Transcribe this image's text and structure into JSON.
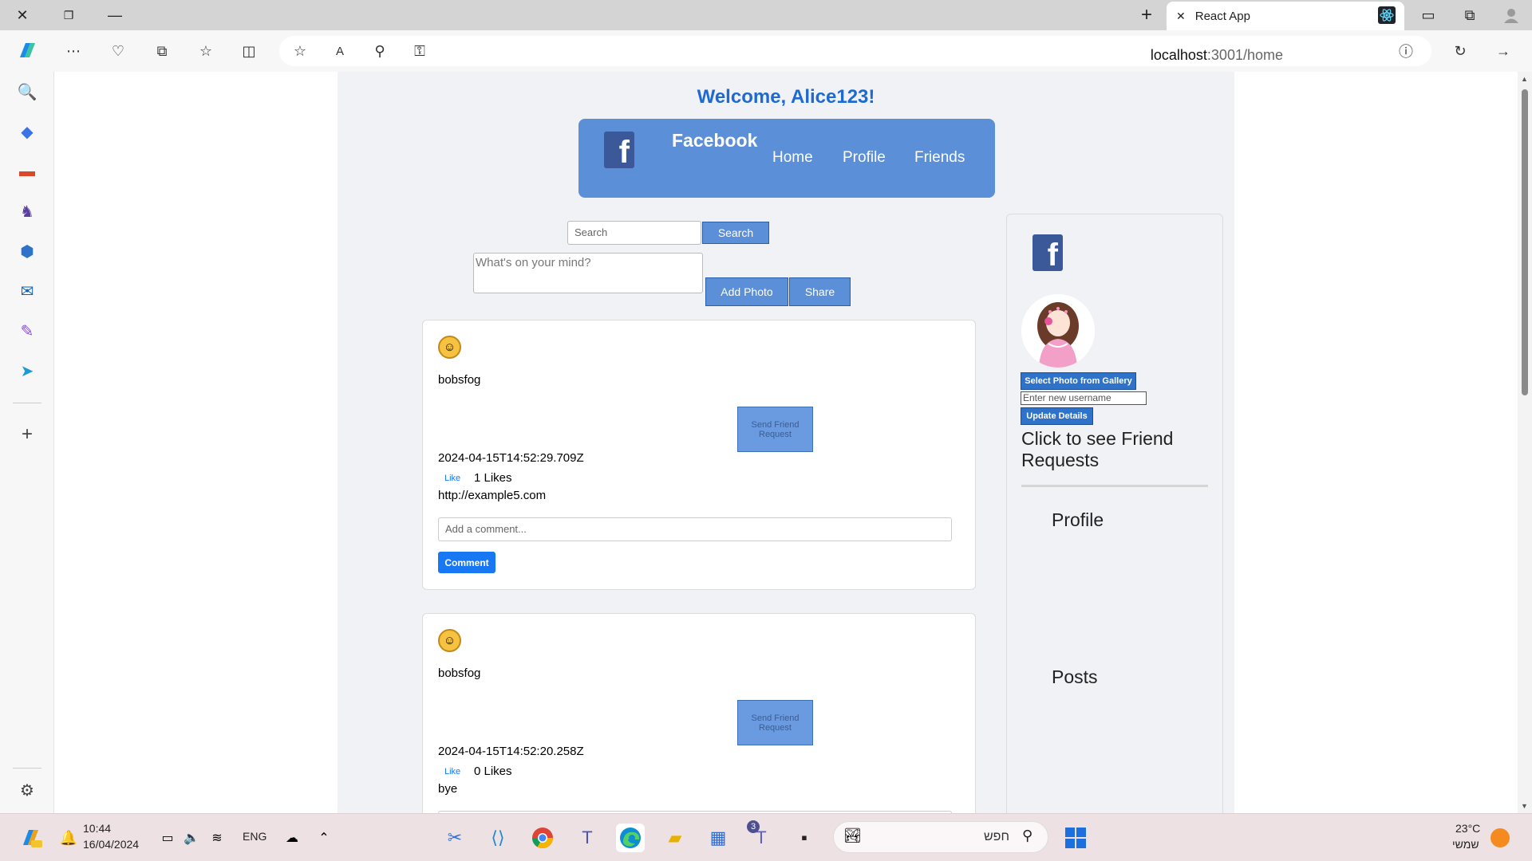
{
  "browser": {
    "tab_title": "React App",
    "url_host": "localhost",
    "url_path": ":3001/home"
  },
  "page": {
    "welcome": "Welcome, Alice123!",
    "nav": {
      "brand": "Facebook",
      "links": [
        "Home",
        "Profile",
        "Friends"
      ]
    },
    "search": {
      "placeholder": "Search",
      "button": "Search"
    },
    "composer": {
      "placeholder": "What's on your mind?",
      "add_photo": "Add Photo",
      "share": "Share"
    },
    "posts": [
      {
        "username": "bobsfog",
        "friend_button": "Send Friend Request",
        "timestamp": "2024-04-15T14:52:29.709Z",
        "like_label": "Like",
        "likes": "1 Likes",
        "content": "http://example5.com",
        "comment_placeholder": "Add a comment...",
        "comment_button": "Comment"
      },
      {
        "username": "bobsfog",
        "friend_button": "Send Friend Request",
        "timestamp": "2024-04-15T14:52:20.258Z",
        "like_label": "Like",
        "likes": "0 Likes",
        "content": "bye"
      }
    ],
    "sidebar": {
      "gallery_button": "Select Photo from Gallery",
      "username_placeholder": "Enter new username",
      "update_button": "Update Details",
      "friend_requests": "Click to see Friend Requests",
      "profile_heading": "Profile",
      "posts_heading": "Posts"
    }
  },
  "taskbar": {
    "time": "10:44",
    "date": "16/04/2024",
    "language": "ENG",
    "search_text": "חפש",
    "weather_temp": "23°C",
    "weather_desc": "שמשי",
    "teams_badge": "3"
  },
  "colors": {
    "accent_blue": "#5b8fd8",
    "welcome_blue": "#1e6ad1",
    "facebook_blue": "#3b5998",
    "comment_blue": "#1877f2"
  }
}
